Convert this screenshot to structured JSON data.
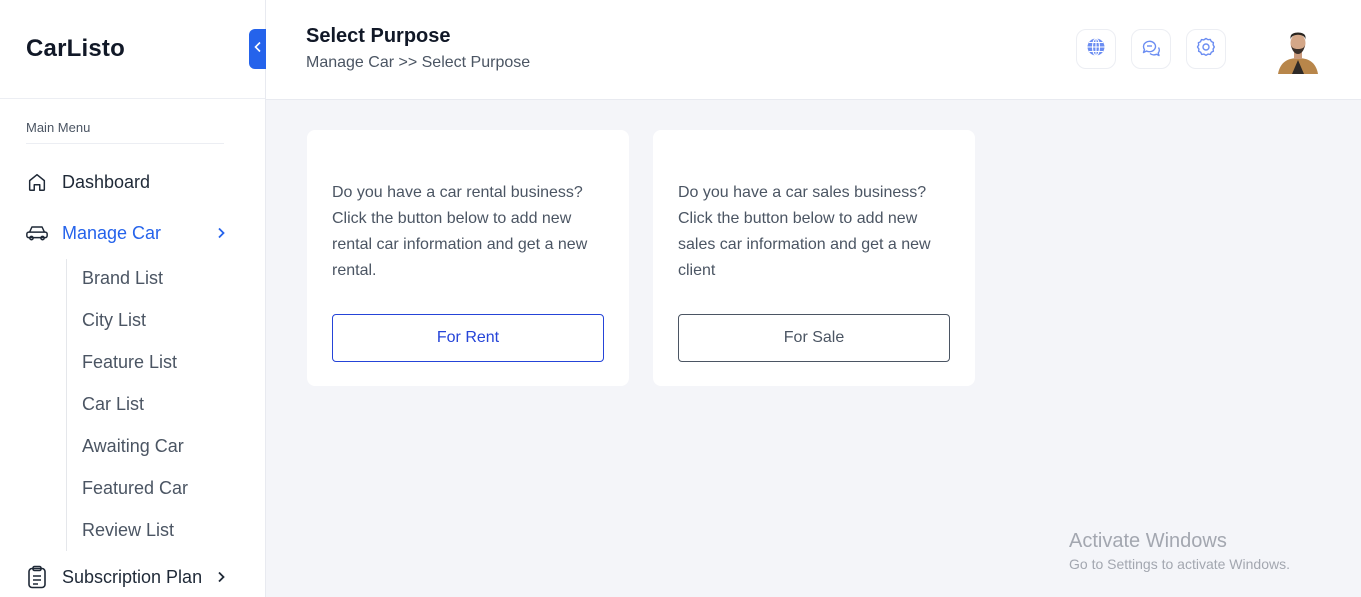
{
  "sidebar": {
    "brand": "CarListo",
    "menu_heading": "Main Menu",
    "items": [
      {
        "label": "Dashboard",
        "icon": "home-icon"
      },
      {
        "label": "Manage Car",
        "icon": "car-icon"
      },
      {
        "label": "Subscription Plan",
        "icon": "clipboard-icon"
      }
    ],
    "sub_items": [
      "Brand List",
      "City List",
      "Feature List",
      "Car List",
      "Awaiting Car",
      "Featured Car",
      "Review List"
    ]
  },
  "header": {
    "title": "Select Purpose",
    "breadcrumb": "Manage Car >> Select Purpose",
    "icons": [
      "globe-icon",
      "chat-icon",
      "gear-icon"
    ]
  },
  "cards": [
    {
      "text": "Do you have a car rental business? Click the button below to add new rental car information and get a new rental.",
      "button": "For Rent"
    },
    {
      "text": "Do you have a car sales business? Click the button below to add new sales car information and get a new client",
      "button": "For Sale"
    }
  ],
  "watermark": {
    "title": "Activate Windows",
    "subtitle": "Go to Settings to activate Windows."
  },
  "colors": {
    "accent": "#2563eb",
    "background": "#f4f5f9",
    "card": "#ffffff"
  }
}
